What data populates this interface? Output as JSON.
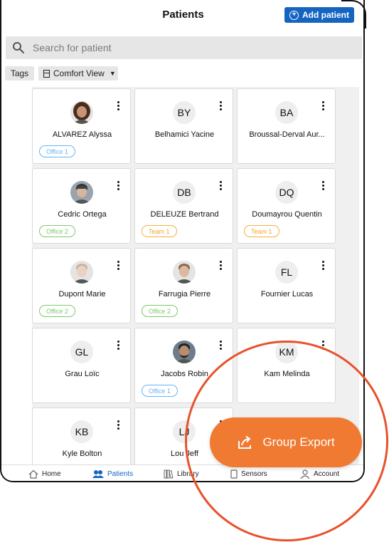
{
  "header": {
    "title": "Patients",
    "add_label": "Add patient"
  },
  "search": {
    "placeholder": "Search for patient"
  },
  "toolbar": {
    "tags_label": "Tags",
    "view_label": "Comfort View"
  },
  "patients": [
    {
      "name": "ALVAREZ Alyssa",
      "initials": "",
      "photo": "woman-curly-hair",
      "tag": "Office 1",
      "tag_color": "blue"
    },
    {
      "name": "Belhamici Yacine",
      "initials": "BY",
      "photo": "",
      "tag": "",
      "tag_color": ""
    },
    {
      "name": "Broussal-Derval Aur...",
      "initials": "BA",
      "photo": "",
      "tag": "",
      "tag_color": ""
    },
    {
      "name": "Cedric Ortega",
      "initials": "",
      "photo": "man-cap",
      "tag": "Office 2",
      "tag_color": "green"
    },
    {
      "name": "DELEUZE Bertrand",
      "initials": "DB",
      "photo": "",
      "tag": "Team 1",
      "tag_color": "orange"
    },
    {
      "name": "Doumayrou Quentin",
      "initials": "DQ",
      "photo": "",
      "tag": "Team 1",
      "tag_color": "orange"
    },
    {
      "name": "Dupont Marie",
      "initials": "",
      "photo": "woman-short-hair",
      "tag": "Office 2",
      "tag_color": "green"
    },
    {
      "name": "Farrugia Pierre",
      "initials": "",
      "photo": "man-smiling",
      "tag": "Office 2",
      "tag_color": "green"
    },
    {
      "name": "Fournier Lucas",
      "initials": "FL",
      "photo": "",
      "tag": "",
      "tag_color": ""
    },
    {
      "name": "Grau Loïc",
      "initials": "GL",
      "photo": "",
      "tag": "",
      "tag_color": ""
    },
    {
      "name": "Jacobs Robin",
      "initials": "",
      "photo": "man-beard",
      "tag": "Office 1",
      "tag_color": "blue"
    },
    {
      "name": "Kam Melinda",
      "initials": "KM",
      "photo": "",
      "tag": "",
      "tag_color": ""
    },
    {
      "name": "Kyle Bolton",
      "initials": "KB",
      "photo": "",
      "tag": "",
      "tag_color": ""
    },
    {
      "name": "Lou Jeff",
      "initials": "LJ",
      "photo": "",
      "tag": "",
      "tag_color": ""
    }
  ],
  "bottom_nav": [
    {
      "label": "Home",
      "icon": "home-icon"
    },
    {
      "label": "Patients",
      "icon": "patients-icon",
      "active": true
    },
    {
      "label": "Library",
      "icon": "library-icon"
    },
    {
      "label": "Sensors",
      "icon": "sensor-icon"
    },
    {
      "label": "Account",
      "icon": "account-icon"
    }
  ],
  "fab": {
    "label": "Group Export",
    "icon": "export-icon"
  },
  "colors": {
    "accent": "#1565c0",
    "fab": "#f07a31",
    "highlight": "#e7522c"
  }
}
